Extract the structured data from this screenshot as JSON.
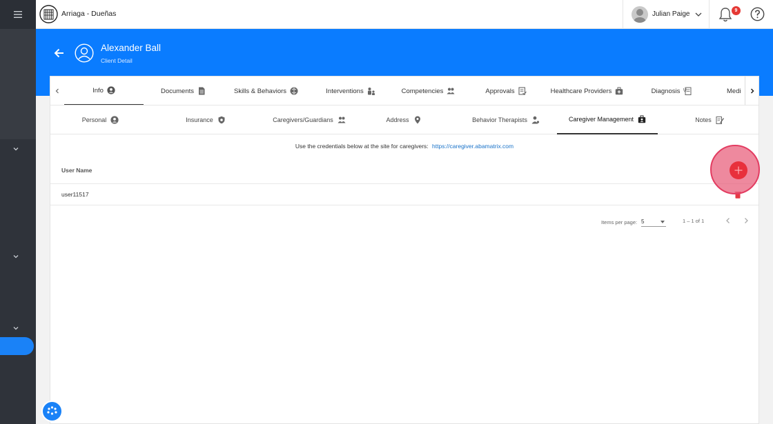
{
  "app": {
    "org_name": "Arriaga - Dueñas",
    "user_name": "Julian Paige",
    "notification_count": "9"
  },
  "client": {
    "name": "Alexander Ball",
    "subtitle": "Client Detail"
  },
  "main_tabs": [
    {
      "label": "Info",
      "icon": "user-circle-icon",
      "active": true
    },
    {
      "label": "Documents",
      "icon": "document-icon",
      "active": false
    },
    {
      "label": "Skills & Behaviors",
      "icon": "brain-icon",
      "active": false
    },
    {
      "label": "Interventions",
      "icon": "intervention-icon",
      "active": false
    },
    {
      "label": "Competencies",
      "icon": "group-icon",
      "active": false
    },
    {
      "label": "Approvals",
      "icon": "approval-icon",
      "active": false
    },
    {
      "label": "Healthcare Providers",
      "icon": "medical-bag-icon",
      "active": false
    },
    {
      "label": "Diagnosis",
      "icon": "diagnosis-icon",
      "active": false
    },
    {
      "label": "Medi",
      "icon": "",
      "active": false
    }
  ],
  "sub_tabs": [
    {
      "label": "Personal",
      "icon": "user-circle-icon",
      "active": false
    },
    {
      "label": "Insurance",
      "icon": "shield-icon",
      "active": false
    },
    {
      "label": "Caregivers/Guardians",
      "icon": "group-icon",
      "active": false
    },
    {
      "label": "Address",
      "icon": "map-pin-icon",
      "active": false
    },
    {
      "label": "Behavior Therapists",
      "icon": "therapist-icon",
      "active": false
    },
    {
      "label": "Caregiver Management",
      "icon": "id-badge-icon",
      "active": true
    },
    {
      "label": "Notes",
      "icon": "notes-icon",
      "active": false
    }
  ],
  "caregiver_management": {
    "info_text": "Use the credentials below at the site for caregivers:",
    "link_text": "https://caregiver.abamatrix.com",
    "column_header": "User Name",
    "rows": [
      {
        "user_name": "user11517"
      }
    ]
  },
  "pagination": {
    "items_per_page_label": "Items per page:",
    "items_per_page_value": "5",
    "range_label": "1 – 1 of 1"
  },
  "colors": {
    "primary": "#0a7cff",
    "sidebar": "#2f333a",
    "fab": "#e8303c",
    "badge": "#e53935",
    "link": "#1a73c9"
  }
}
